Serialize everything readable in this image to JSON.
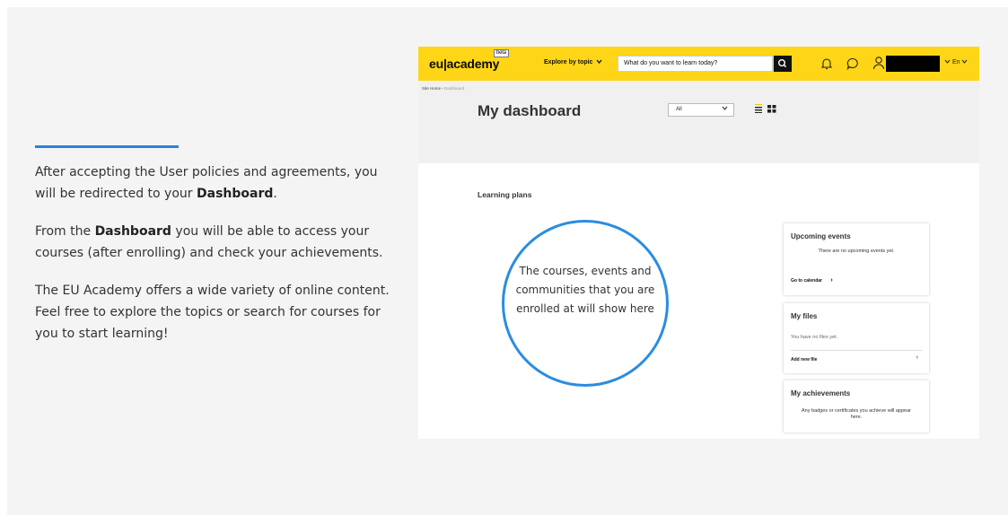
{
  "slide": {
    "paragraphs": [
      {
        "pre": "After accepting the User policies and agreements, you will be redirected to your ",
        "bold": "Dashboard",
        "post": "."
      },
      {
        "pre": "From the ",
        "bold": "Dashboard",
        "post": " you will be able to access your courses (after enrolling) and check your achievements."
      },
      {
        "pre": "The EU Academy offers a wide variety of online content. Feel free to explore the topics or search for courses for you to start learning!",
        "bold": "",
        "post": ""
      }
    ]
  },
  "app": {
    "logo": "eu|academy",
    "beta": "beta",
    "explore": "Explore by topic",
    "search_placeholder": "What do you want to learn today?",
    "lang": "En",
    "breadcrumb": {
      "home": "Site Home",
      "sep": "›",
      "current": "Dashboard"
    },
    "title": "My dashboard",
    "filter": "All",
    "learning_plans": "Learning plans",
    "empty_circle_text": "The courses, events and communities that you are enrolled at will show here",
    "upcoming": {
      "title": "Upcoming events",
      "body": "There are no upcoming events yet.",
      "link": "Go to calendar"
    },
    "files": {
      "title": "My files",
      "body": "You have no files yet.",
      "link": "Add new file"
    },
    "achievements": {
      "title": "My achievements",
      "body": "Any badges or certificates you achieve will appear here."
    }
  },
  "colors": {
    "accent": "#2b82d9",
    "topbar": "#ffd617"
  },
  "icons": [
    "chevron-down-icon",
    "search-icon",
    "bell-icon",
    "chat-icon",
    "user-icon",
    "list-view-icon",
    "grid-view-icon",
    "chevron-right-icon"
  ]
}
